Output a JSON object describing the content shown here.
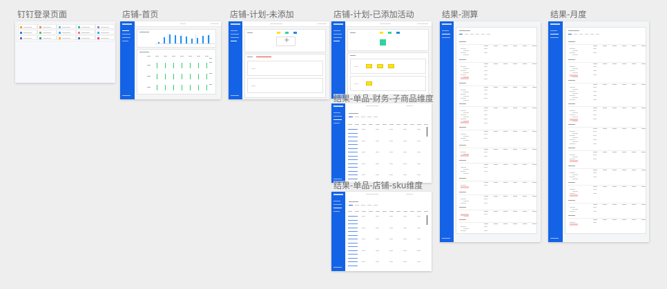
{
  "boards": {
    "dingtalk_login": {
      "label": "钉钉登录页面"
    },
    "shop_home": {
      "label": "店铺-首页"
    },
    "shop_plan_empty": {
      "label": "店铺-计划-未添加"
    },
    "shop_plan_added": {
      "label": "店铺-计划-已添加活动"
    },
    "result_calc": {
      "label": "结果-测算"
    },
    "result_monthly": {
      "label": "结果-月度"
    },
    "result_item_finance": {
      "label": "结果-单品-财务-子商品维度"
    },
    "result_item_shop_sku": {
      "label": "结果-单品-店铺-sku维度"
    }
  },
  "colors": {
    "sidebar": "#1463e6",
    "chart_bar": "#1890ff",
    "green_bar": "#2ecc71",
    "yellow_chip": "#ffe11a",
    "teal_chip": "#2ed3a0",
    "highlight_row": "#f7c6c6",
    "canvas": "#eeeeee"
  },
  "icons": {
    "plus": "+",
    "tile_colors": [
      "#f5a623",
      "#f08a5d",
      "#4fc3f7",
      "#26c6a6",
      "#9c7bd9",
      "#1e88e5",
      "#66bb6a",
      "#42a5f5",
      "#ef7c8e",
      "#29b6f6",
      "#7e57c2",
      "#26a69a",
      "#ffa726",
      "#5c6bc0",
      "#ec407a",
      "#8d6e63",
      "#78909c",
      "#ab47bc",
      "#ffca28",
      "#4db6ac"
    ]
  }
}
